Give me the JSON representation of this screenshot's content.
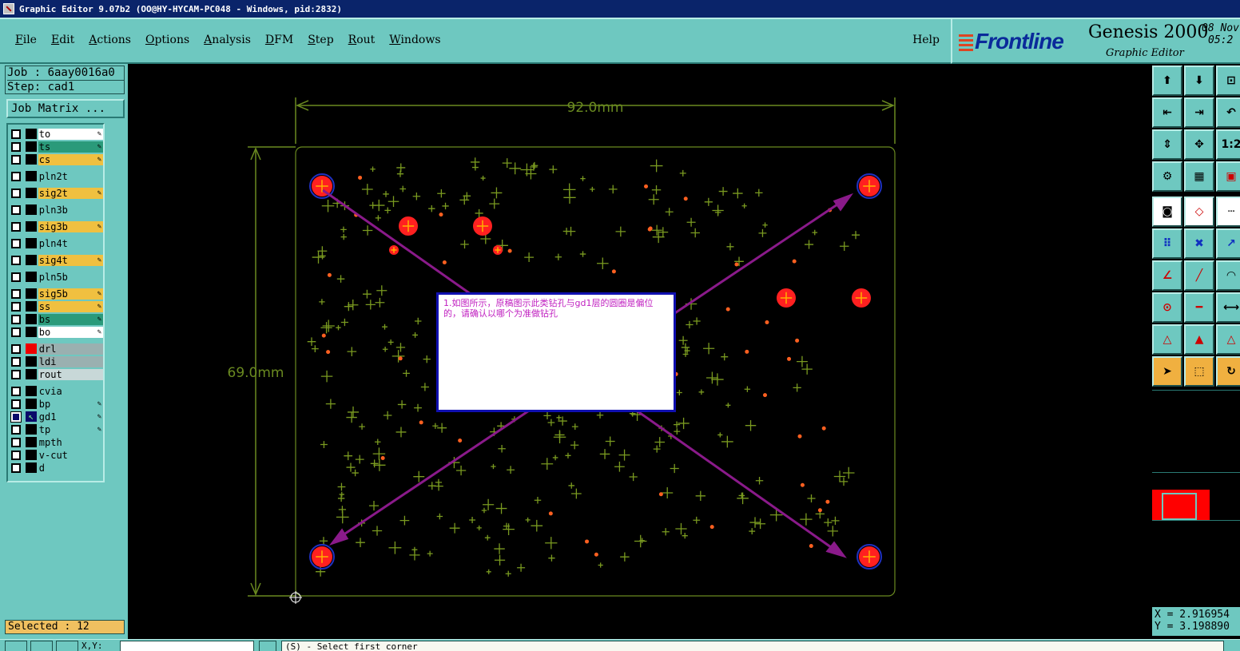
{
  "window": {
    "title": "Graphic Editor 9.07b2 (OO@HY-HYCAM-PC048 - Windows, pid:2832)"
  },
  "menu": {
    "items": [
      "File",
      "Edit",
      "Actions",
      "Options",
      "Analysis",
      "DFM",
      "Step",
      "Rout",
      "Windows"
    ],
    "help": "Help"
  },
  "brand": {
    "logo": "Frontline",
    "product": "Genesis 2000",
    "subtitle": "Graphic Editor",
    "date_line1": "08 Nov",
    "date_line2": "05:2"
  },
  "job": {
    "job": "Job : 6aay0016a0",
    "step": "Step: cad1"
  },
  "job_matrix_label": "Job Matrix ...",
  "layers": [
    {
      "name": "to",
      "color": "#ffffff",
      "affected": true
    },
    {
      "name": "ts",
      "color": "#2a9a7a",
      "affected": true
    },
    {
      "name": "cs",
      "color": "#f0c040",
      "affected": true
    },
    {
      "name": "pln2t",
      "color": "#6ec8c0",
      "affected": false
    },
    {
      "name": "sig2t",
      "color": "#f0c040",
      "affected": true
    },
    {
      "name": "pln3b",
      "color": "#6ec8c0",
      "affected": false
    },
    {
      "name": "sig3b",
      "color": "#f0c040",
      "affected": true
    },
    {
      "name": "pln4t",
      "color": "#6ec8c0",
      "affected": false
    },
    {
      "name": "sig4t",
      "color": "#f0c040",
      "affected": true
    },
    {
      "name": "pln5b",
      "color": "#6ec8c0",
      "affected": false
    },
    {
      "name": "sig5b",
      "color": "#f0c040",
      "affected": true
    },
    {
      "name": "ss",
      "color": "#f0c040",
      "affected": true
    },
    {
      "name": "bs",
      "color": "#2a9a7a",
      "affected": true
    },
    {
      "name": "bo",
      "color": "#ffffff",
      "affected": true
    },
    {
      "name": "drl",
      "color": "#9ab0b0",
      "affected": false
    },
    {
      "name": "ldi",
      "color": "#9ab0b0",
      "affected": false
    },
    {
      "name": "rout",
      "color": "#c8d8d8",
      "affected": false
    },
    {
      "name": "cvia",
      "color": "#6ec8c0",
      "affected": false
    },
    {
      "name": "bp",
      "color": "#6ec8c0",
      "affected": true
    },
    {
      "name": "gd1",
      "color": "#6ec8c0",
      "affected": true
    },
    {
      "name": "tp",
      "color": "#6ec8c0",
      "affected": true
    },
    {
      "name": "mpth",
      "color": "#6ec8c0",
      "affected": false
    },
    {
      "name": "v-cut",
      "color": "#6ec8c0",
      "affected": false
    },
    {
      "name": "d",
      "color": "#6ec8c0",
      "affected": false
    }
  ],
  "selected": "Selected : 12",
  "dimensions": {
    "width": "92.0mm",
    "height": "69.0mm"
  },
  "note": {
    "text": "1.如图所示，原稿图示此类钻孔与gd1层的圆圈是偏位的，请确认以哪个为准做钻孔"
  },
  "coords": {
    "x": "X = 2.916954",
    "y": "Y = 3.198890"
  },
  "status": {
    "xy_label": "X,Y:",
    "prompt": "(S) - Select first corner"
  },
  "colors": {
    "panel": "#6ec8c0",
    "pcb_green": "#7a9a20",
    "drill_red": "#ff2020",
    "arrow_purple": "#8a1a8a",
    "outline": "#6a8a20"
  }
}
